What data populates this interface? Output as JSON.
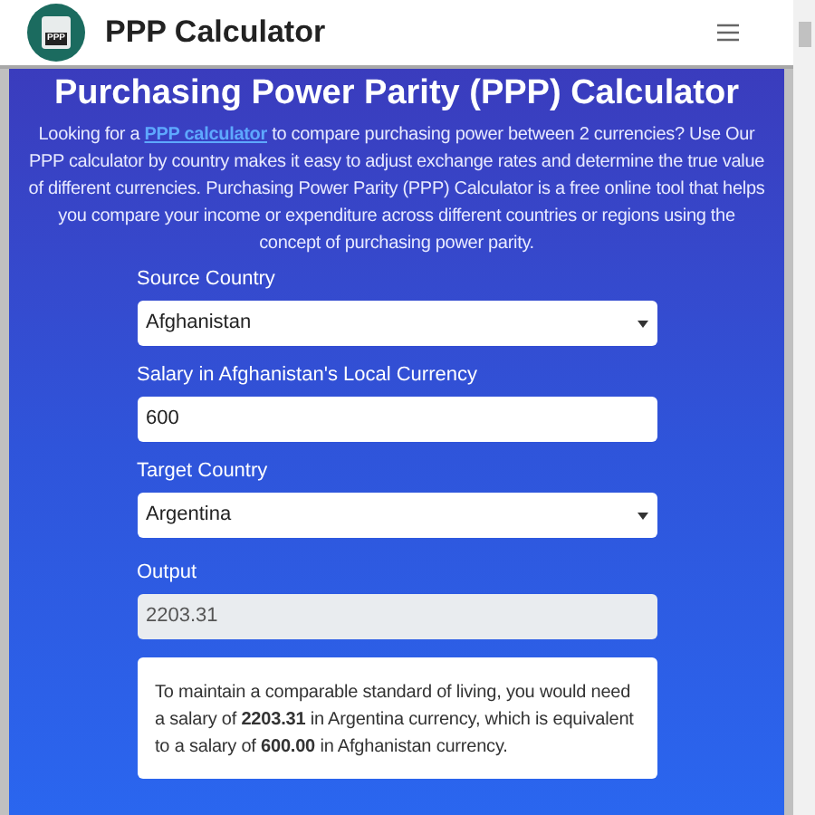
{
  "header": {
    "title": "PPP Calculator",
    "logo_text": "PPP"
  },
  "hero": {
    "title": "Purchasing Power Parity (PPP) Calculator",
    "intro_before": "Looking for a",
    "intro_link": "PPP calculator",
    "intro_after": "to compare purchasing power between 2 currencies? Use Our PPP calculator by country makes it easy to adjust exchange rates and determine the true value of different currencies. Purchasing Power Parity (PPP) Calculator is a free online tool that helps you compare your income or expenditure across different countries or regions using the concept of purchasing power parity."
  },
  "form": [
    {
      "kind": "select",
      "label": "Source Country",
      "value": "Afghanistan"
    },
    {
      "kind": "input",
      "label": "Salary in Afghanistan's Local Currency",
      "value": "600"
    },
    {
      "kind": "select",
      "label": "Target Country",
      "value": "Argentina"
    }
  ],
  "output": {
    "label": "Output",
    "value": "2203.31",
    "disabled": true,
    "result": "To maintain a comparable standard of living, you would need a salary of **2203.31** in Argentina currency, which is equivalent to a salary of **600.00** in Afghanistan currency."
  }
}
